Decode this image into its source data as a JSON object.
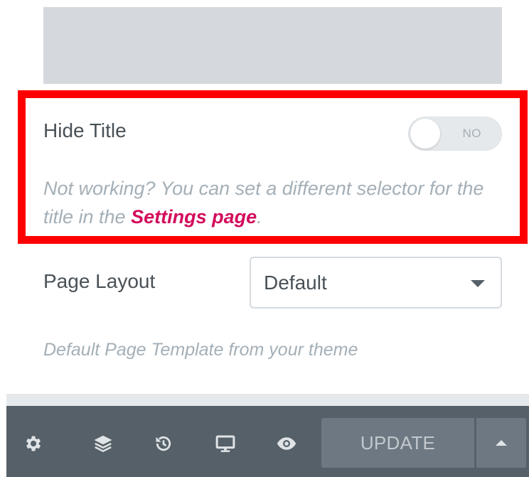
{
  "hide_title": {
    "label": "Hide Title",
    "toggle_text": "NO",
    "toggle_state": "off"
  },
  "help": {
    "text_before": "Not working? You can set a different selector for the title in the ",
    "link_text": "Settings page",
    "text_after": "."
  },
  "page_layout": {
    "label": "Page Layout",
    "selected": "Default",
    "description": "Default Page Template from your theme"
  },
  "footer": {
    "icons": [
      "gear-icon",
      "layers-icon",
      "history-icon",
      "responsive-desktop-icon",
      "preview-eye-icon"
    ],
    "update_label": "UPDATE"
  },
  "colors": {
    "highlight": "#ff0000",
    "link": "#d30c5c",
    "footer_bg": "#556068",
    "placeholder_bg": "#d5d8dc"
  }
}
